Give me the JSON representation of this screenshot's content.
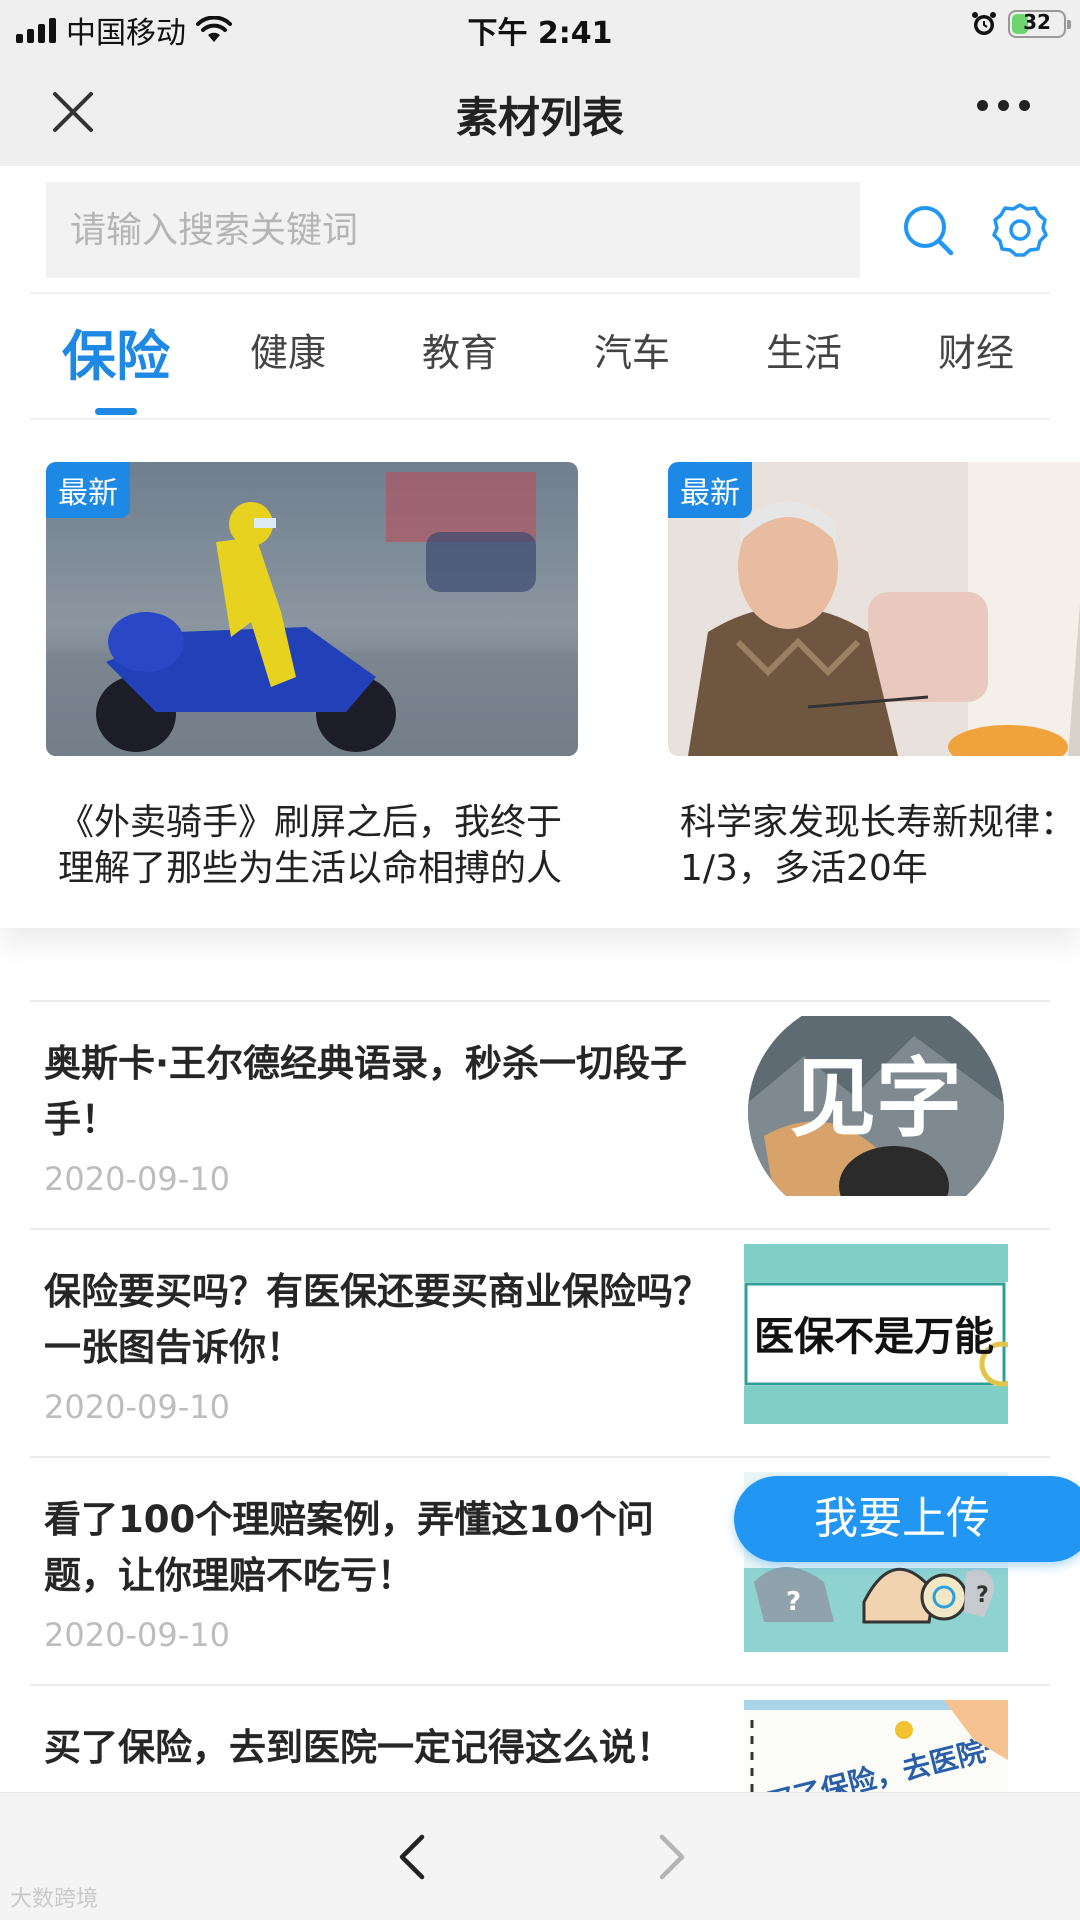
{
  "status_bar": {
    "carrier": "中国移动",
    "time": "下午 2:41",
    "battery_level": "32",
    "signal_bars": 4
  },
  "nav": {
    "title": "素材列表",
    "close_icon": "close-icon",
    "more_icon": "more-icon"
  },
  "search": {
    "placeholder": "请输入搜索关键词",
    "value": "",
    "search_icon": "search-icon",
    "settings_icon": "gear-icon"
  },
  "tabs": [
    {
      "label": "保险",
      "active": true
    },
    {
      "label": "健康",
      "active": false
    },
    {
      "label": "教育",
      "active": false
    },
    {
      "label": "汽车",
      "active": false
    },
    {
      "label": "生活",
      "active": false
    },
    {
      "label": "财经",
      "active": false
    }
  ],
  "featured": [
    {
      "badge": "最新",
      "title_line1": "《外卖骑手》刷屏之后，我终于",
      "title_line2": "理解了那些为生活以命相搏的人"
    },
    {
      "badge": "最新",
      "title_line1": "科学家发现长寿新规律：",
      "title_line2": "1/3，多活20年"
    }
  ],
  "articles": [
    {
      "title": "奥斯卡·王尔德经典语录，秒杀一切段子手！",
      "date": "2020-09-10",
      "thumb_text": "见字"
    },
    {
      "title": "保险要买吗？有医保还要买商业保险吗？一张图告诉你！",
      "date": "2020-09-10",
      "thumb_text": "医保不是万能"
    },
    {
      "title": "看了100个理赔案例，弄懂这10个问题，让你理赔不吃亏！",
      "date": "2020-09-10",
      "thumb_text": ""
    },
    {
      "title": "买了保险，去到医院一定记得这么说！",
      "date": "",
      "thumb_text": "买了保险，去医院一定记"
    }
  ],
  "upload": {
    "label": "我要上传"
  },
  "bottom": {
    "back_icon": "chevron-left-icon",
    "forward_icon": "chevron-right-icon",
    "watermark": "大数跨境"
  },
  "colors": {
    "accent": "#1e88e5",
    "upload": "#2196f3",
    "date": "#bdbdbd"
  }
}
